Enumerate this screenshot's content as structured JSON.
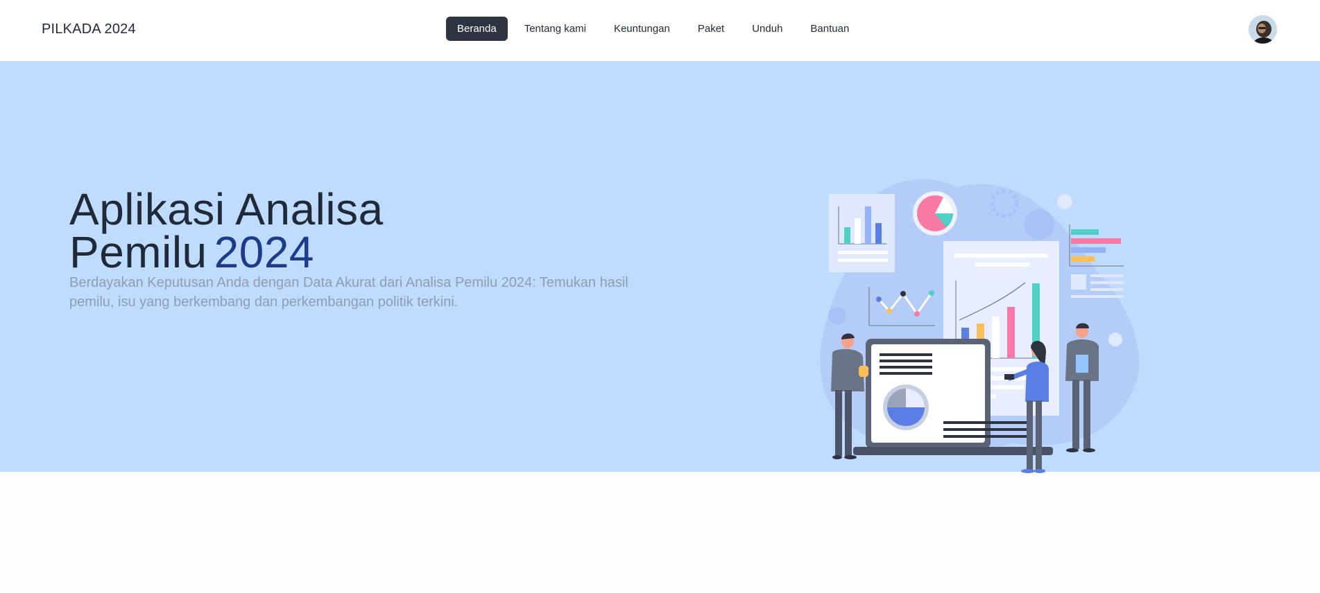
{
  "navbar": {
    "brand": "PILKADA 2024",
    "items": [
      {
        "label": "Beranda",
        "active": true
      },
      {
        "label": "Tentang kami",
        "active": false
      },
      {
        "label": "Keuntungan",
        "active": false
      },
      {
        "label": "Paket",
        "active": false
      },
      {
        "label": "Unduh",
        "active": false
      },
      {
        "label": "Bantuan",
        "active": false
      }
    ]
  },
  "hero": {
    "title_line1": "Aplikasi Analisa",
    "title_line2": "Pemilu",
    "title_year": "2024",
    "description": "Berdayakan Keputusan Anda dengan Data Akurat dari Analisa Pemilu 2024: Temukan hasil pemilu, isu yang berkembang dan perkembangan politik terkini.",
    "illustration": "data-analytics-illustration"
  },
  "colors": {
    "hero_bg": "#bfdbfd",
    "active_nav_bg": "#2d3440",
    "accent_year": "#1e3a8a"
  }
}
